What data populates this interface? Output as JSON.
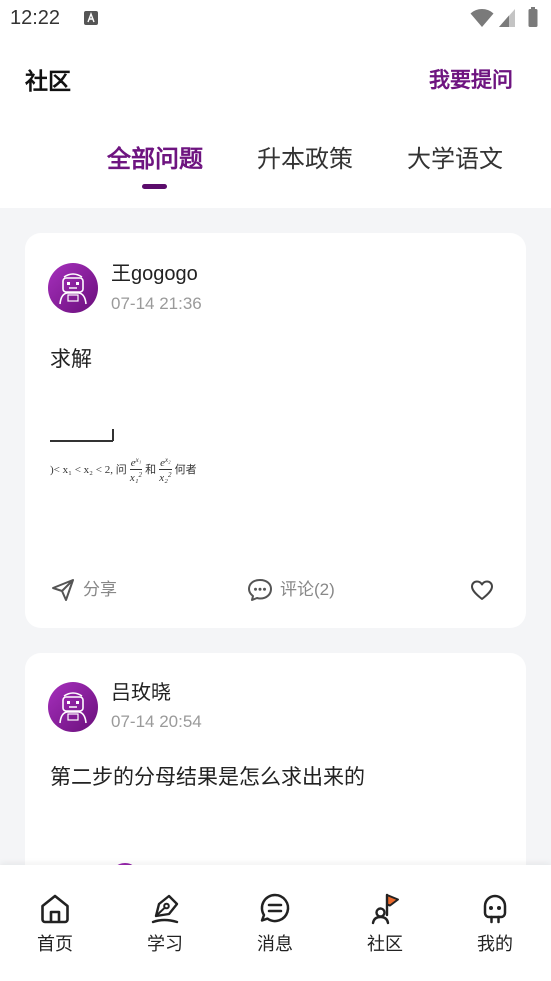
{
  "status_bar": {
    "time": "12:22",
    "icons": [
      "app-notification-icon",
      "wifi-icon",
      "signal-icon",
      "battery-icon"
    ]
  },
  "header": {
    "title": "社区",
    "ask_label": "我要提问"
  },
  "tabs": [
    {
      "label": "全部问题",
      "active": true
    },
    {
      "label": "升本政策",
      "active": false
    },
    {
      "label": "大学语文",
      "active": false
    }
  ],
  "posts": [
    {
      "author": "王gogogo",
      "time": "07-14 21:36",
      "content": "求解",
      "attachment": {
        "lead": ")< x₁ < x₂ < 2, 问",
        "frac_1": {
          "num": "e",
          "num_sup": "x₁",
          "den": "x₁",
          "den_sup": "2"
        },
        "conj": "和",
        "frac_2": {
          "num": "e",
          "num_sup": "x₂",
          "den": "x₂",
          "den_sup": "2"
        },
        "tail": "何者"
      },
      "actions": {
        "share_label": "分享",
        "comment_label": "评论(2)",
        "share_icon": "paper-plane-icon",
        "comment_icon": "comment-icon",
        "like_icon": "heart-icon"
      },
      "liked": false
    },
    {
      "author": "吕玫晓",
      "time": "07-14 20:54",
      "content": "第二步的分母结果是怎么求出来的"
    }
  ],
  "bottom_nav": [
    {
      "label": "首页",
      "icon": "home-icon",
      "active": false
    },
    {
      "label": "学习",
      "icon": "pen-icon",
      "active": false
    },
    {
      "label": "消息",
      "icon": "message-icon",
      "active": false
    },
    {
      "label": "社区",
      "icon": "community-flag-icon",
      "active": true
    },
    {
      "label": "我的",
      "icon": "profile-face-icon",
      "active": false
    }
  ],
  "colors": {
    "accent": "#6e1480",
    "tab_indicator": "#5b0c6b",
    "page_background": "#f4f5f7",
    "flag": "#ec6a2c",
    "muted_text": "#9a9a9a",
    "action_text": "#888888"
  }
}
